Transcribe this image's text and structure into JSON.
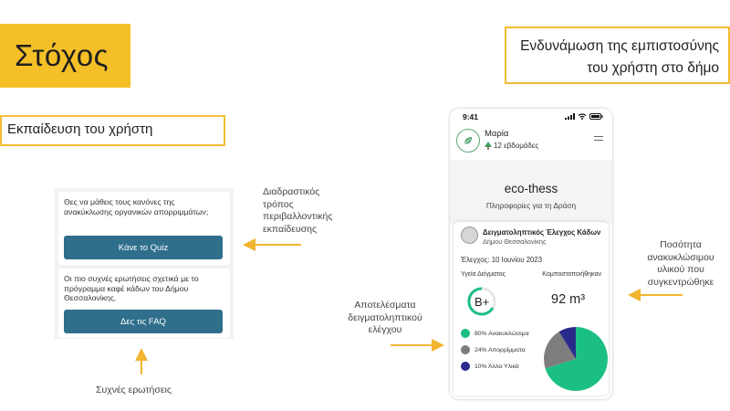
{
  "goal": {
    "title": "Στόχος"
  },
  "trust": {
    "line1": "Ενδυνάμωση της εμπιστοσύνης",
    "line2": "του χρήστη στο δήμο"
  },
  "education": {
    "label": "Εκπαίδευση του χρήστη"
  },
  "left_mock": {
    "card1_text": "Θες να μάθεις τους κανόνες της ανακύκλωσης οργανικών απορριμμάτων;",
    "card1_button": "Κάνε το Quiz",
    "card2_text": "Οι πιο συχνές ερωτήσεις σχετικά με το πρόγραμμα καφέ κάδων του Δήμου Θεσσαλονίκης.",
    "card2_button": "Δες τις FAQ"
  },
  "annotations": {
    "interactive": [
      "Διαδραστικός",
      "τρόπος",
      "περιβαλλοντικής",
      "εκπαίδευσης"
    ],
    "faq": "Συχνές ερωτήσεις",
    "results": [
      "Αποτελέσματα",
      "δειγματοληπτικού",
      "ελέγχου"
    ],
    "quantity": [
      "Ποσότητα",
      "ανακυκλώσιμου",
      "υλικού που",
      "συγκεντρώθηκε"
    ]
  },
  "phone": {
    "time": "9:41",
    "user_name": "Μαρία",
    "weeks": "12 εβδομάδες",
    "app_title": "eco-thess",
    "app_subtitle": "Πληροφορίες για τη Δράση",
    "card": {
      "title": "Δειγματοληπτικός Έλεγχος Κάδων",
      "municipality": "Δήμου Θεσσαλονίκης",
      "date": "Έλεγχος: 10 Ιουνίου 2023",
      "health_label": "Υγεία Δείγματος",
      "compost_label": "Κομποστοποιήθηκαν",
      "grade": "B+",
      "volume": "92 m³",
      "legend": [
        {
          "label": "80% Ανακυκλώσιμα",
          "color": "#1bbf83",
          "value": 80
        },
        {
          "label": "24% Απορρίμματα",
          "color": "#7d7d7d",
          "value": 24
        },
        {
          "label": "10% Άλλα Υλικά",
          "color": "#2a2a8c",
          "value": 10
        }
      ]
    }
  },
  "colors": {
    "accent": "#f5c027",
    "outline": "#f2bd33",
    "button": "#2f6f8c",
    "arrow": "#f2b531",
    "green": "#1bbf83"
  }
}
